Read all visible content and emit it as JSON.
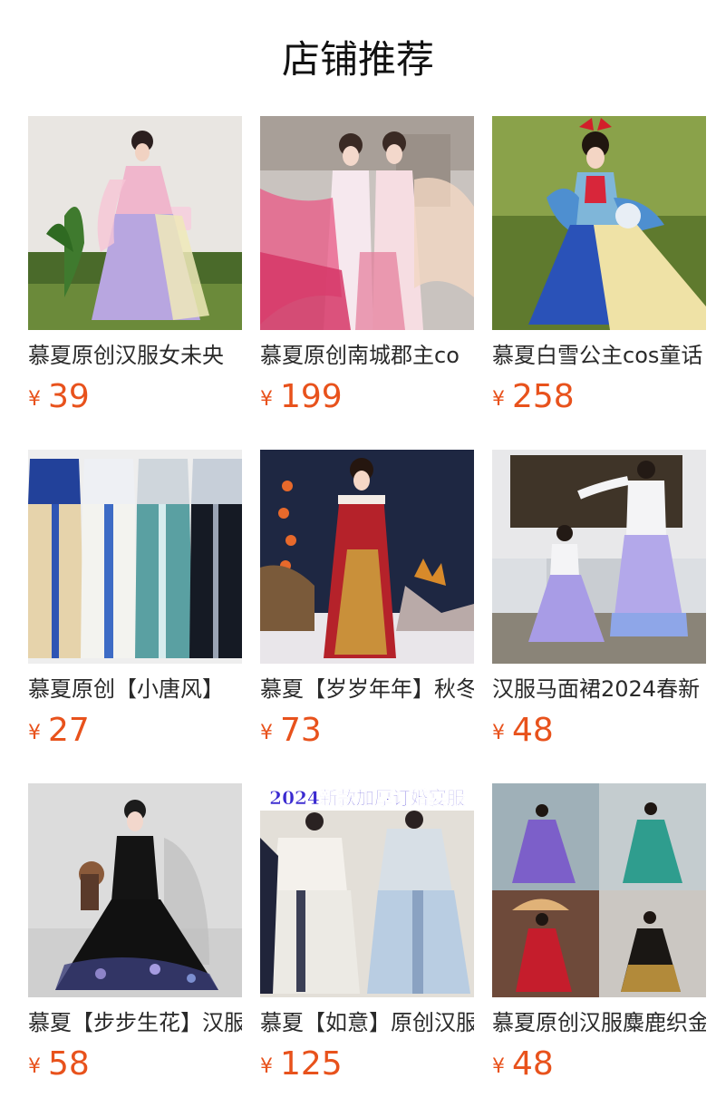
{
  "page": {
    "title": "店铺推荐"
  },
  "products": [
    {
      "name": "慕夏原创汉服女未央",
      "currency": "¥",
      "price": "39",
      "image": "pink-lavender-hanfu-photo"
    },
    {
      "name": "慕夏原创南城郡主co",
      "currency": "¥",
      "price": "199",
      "image": "pink-gradient-hanfu-pair-photo"
    },
    {
      "name": "慕夏白雪公主cos童话",
      "currency": "¥",
      "price": "258",
      "image": "snow-white-hanfu-photo"
    },
    {
      "name": "慕夏原创【小唐风】",
      "currency": "¥",
      "price": "27",
      "image": "four-tang-style-skirts-photo"
    },
    {
      "name": "慕夏【岁岁年年】秋冬",
      "currency": "¥",
      "price": "73",
      "image": "red-winter-hanfu-photo"
    },
    {
      "name": "汉服马面裙2024春新",
      "currency": "¥",
      "price": "48",
      "image": "mother-daughter-mamian-skirt-photo"
    },
    {
      "name": "慕夏【步步生花】汉服",
      "currency": "¥",
      "price": "58",
      "image": "black-floral-hanfu-photo"
    },
    {
      "name": "慕夏【如意】原创汉服",
      "currency": "¥",
      "price": "125",
      "image": "thick-wedding-hanfu-pair-photo",
      "banner": "2024新款加厚订婚宴服"
    },
    {
      "name": "慕夏原创汉服麋鹿织金",
      "currency": "¥",
      "price": "48",
      "image": "mamian-skirt-collage-photo"
    }
  ]
}
